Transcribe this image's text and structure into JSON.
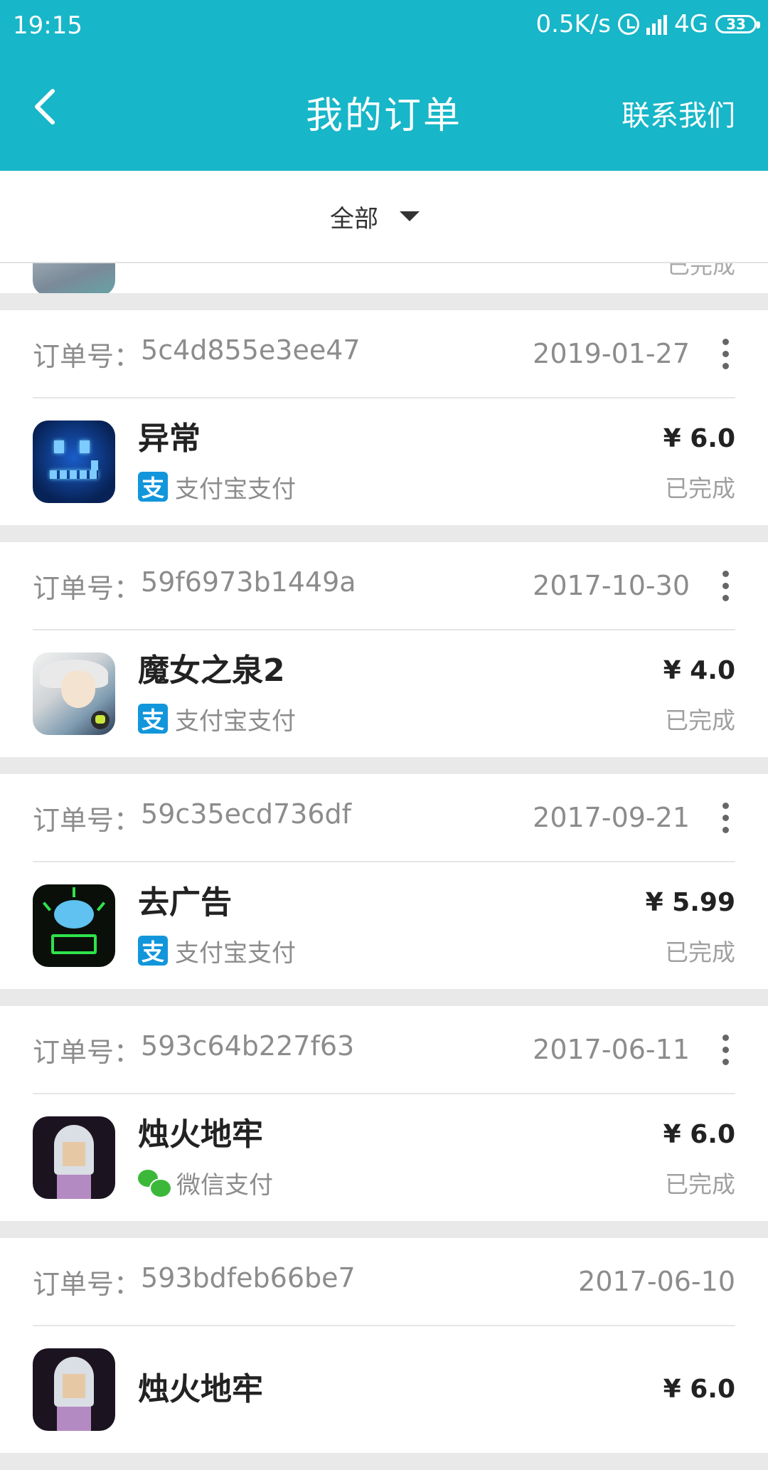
{
  "status_bar": {
    "time": "19:15",
    "net_speed": "0.5K/s",
    "network": "4G",
    "battery": "33"
  },
  "app_bar": {
    "title": "我的订单",
    "contact_label": "联系我们",
    "back_icon": "chevron-left-icon",
    "background_color": "#17b6c8"
  },
  "filter": {
    "label": "全部",
    "icon": "caret-down-icon"
  },
  "labels": {
    "order_no_prefix": "订单号：",
    "currency": "¥ "
  },
  "partial_top": {
    "status": "已完成"
  },
  "orders": [
    {
      "order_no": "5c4d855e3ee47",
      "date": "2019-01-27",
      "app_name": "异常",
      "payment": "支付宝支付",
      "payment_icon": "alipay-icon",
      "price": "6.0",
      "status": "已完成",
      "has_more": true
    },
    {
      "order_no": "59f6973b1449a",
      "date": "2017-10-30",
      "app_name": "魔女之泉2",
      "payment": "支付宝支付",
      "payment_icon": "alipay-icon",
      "price": "4.0",
      "status": "已完成",
      "has_more": true
    },
    {
      "order_no": "59c35ecd736df",
      "date": "2017-09-21",
      "app_name": "去广告",
      "payment": "支付宝支付",
      "payment_icon": "alipay-icon",
      "price": "5.99",
      "status": "已完成",
      "has_more": true
    },
    {
      "order_no": "593c64b227f63",
      "date": "2017-06-11",
      "app_name": "烛火地牢",
      "payment": "微信支付",
      "payment_icon": "wechat-icon",
      "price": "6.0",
      "status": "已完成",
      "has_more": true
    },
    {
      "order_no": "593bdfeb66be7",
      "date": "2017-06-10",
      "app_name": "烛火地牢",
      "payment": "",
      "payment_icon": "",
      "price": "6.0",
      "status": "",
      "has_more": false
    }
  ]
}
